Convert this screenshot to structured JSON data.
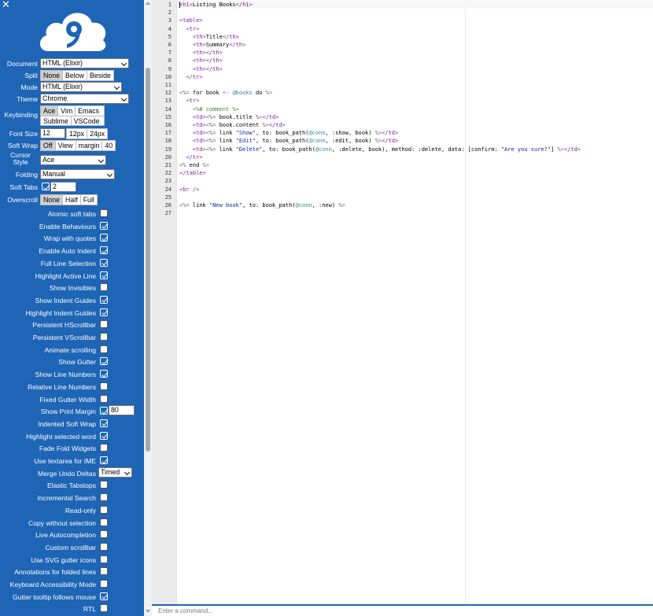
{
  "window": {
    "close_glyph": "✕"
  },
  "sidebar": {
    "logo_icon": "cloud9-logo",
    "document": {
      "label": "Document",
      "value": "HTML (Elixir)"
    },
    "split": {
      "label": "Split",
      "options": [
        "None",
        "Below",
        "Beside"
      ],
      "selected": "None"
    },
    "mode": {
      "label": "Mode",
      "value": "HTML (Elixir)"
    },
    "theme": {
      "label": "Theme",
      "value": "Chrome"
    },
    "keybinding": {
      "label": "Keybinding",
      "options": [
        "Ace",
        "Vim",
        "Emacs",
        "Sublime",
        "VSCode"
      ],
      "selected": "Ace"
    },
    "font_size": {
      "label": "Font Size",
      "value": "12",
      "options": [
        "12px",
        "24px"
      ]
    },
    "soft_wrap": {
      "label": "Soft Wrap",
      "options": [
        "Off",
        "View",
        "margin",
        "40"
      ],
      "selected": "Off"
    },
    "cursor_style": {
      "label": "Cursor Style",
      "value": "Ace"
    },
    "folding": {
      "label": "Folding",
      "value": "Manual"
    },
    "soft_tabs": {
      "label": "Soft Tabs",
      "checked": true,
      "value": "2"
    },
    "overscroll": {
      "label": "Overscroll",
      "options": [
        "None",
        "Half",
        "Full"
      ],
      "selected": "None"
    },
    "checkboxes": [
      {
        "label": "Atomic soft tabs",
        "checked": false
      },
      {
        "label": "Enable Behaviours",
        "checked": true
      },
      {
        "label": "Wrap with quotes",
        "checked": true
      },
      {
        "label": "Enable Auto Indent",
        "checked": true
      },
      {
        "label": "Full Line Selection",
        "checked": true
      },
      {
        "label": "Highlight Active Line",
        "checked": true
      },
      {
        "label": "Show Invisibles",
        "checked": false
      },
      {
        "label": "Show Indent Guides",
        "checked": true
      },
      {
        "label": "Highlight Indent Guides",
        "checked": true
      },
      {
        "label": "Persistent HScrollbar",
        "checked": false
      },
      {
        "label": "Persistent VScrollbar",
        "checked": false
      },
      {
        "label": "Animate scrolling",
        "checked": false
      },
      {
        "label": "Show Gutter",
        "checked": true
      },
      {
        "label": "Show Line Numbers",
        "checked": true
      },
      {
        "label": "Relative Line Numbers",
        "checked": false
      },
      {
        "label": "Fixed Gutter Width",
        "checked": false
      },
      {
        "label": "Show Print Margin",
        "checked": true,
        "value": "80"
      },
      {
        "label": "Indented Soft Wrap",
        "checked": true
      },
      {
        "label": "Highlight selected word",
        "checked": true
      },
      {
        "label": "Fade Fold Widgets",
        "checked": false
      },
      {
        "label": "Use textarea for IME",
        "checked": true
      },
      {
        "label": "Merge Undo Deltas",
        "select": "Timed"
      },
      {
        "label": "Elastic Tabstops",
        "checked": false
      },
      {
        "label": "Incremental Search",
        "checked": false
      },
      {
        "label": "Read-only",
        "checked": false
      },
      {
        "label": "Copy without selection",
        "checked": false
      },
      {
        "label": "Live Autocompletion",
        "checked": false
      },
      {
        "label": "Custom scrollbar",
        "checked": false
      },
      {
        "label": "Use SVG gutter icons",
        "checked": false
      },
      {
        "label": "Annotations for folded lines",
        "checked": false
      },
      {
        "label": "Keyboard Accessibility Mode",
        "checked": false
      },
      {
        "label": "Gutter tooltip follows mouse",
        "checked": true
      },
      {
        "label": "RTL",
        "checked": false
      }
    ]
  },
  "editor": {
    "lines": [
      "<h1>Listing Books</h1>",
      "",
      "<table>",
      "  <tr>",
      "    <th>Title</th>",
      "    <th>Summary</th>",
      "    <th></th>",
      "    <th></th>",
      "    <th></th>",
      "  </tr>",
      "",
      "<%= for book <- @books do %>",
      "  <tr>",
      "    <%# comment %>",
      "    <td><%= book.title %></td>",
      "    <td><%= book.content %></td>",
      "    <td><%= link \"Show\", to: book_path(@conn, :show, book) %></td>",
      "    <td><%= link \"Edit\", to: book_path(@conn, :edit, book) %></td>",
      "    <td><%= link \"Delete\", to: book_path(@conn, :delete, book), method: :delete, data: [confirm: \"Are you sure?\"] %></td>",
      "  </tr>",
      "<% end %>",
      "</table>",
      "",
      "<br />",
      "",
      "<%= link \"New book\", to: book_path(@conn, :new) %>",
      ""
    ]
  },
  "command_bar": {
    "placeholder": "Enter a command..."
  }
}
